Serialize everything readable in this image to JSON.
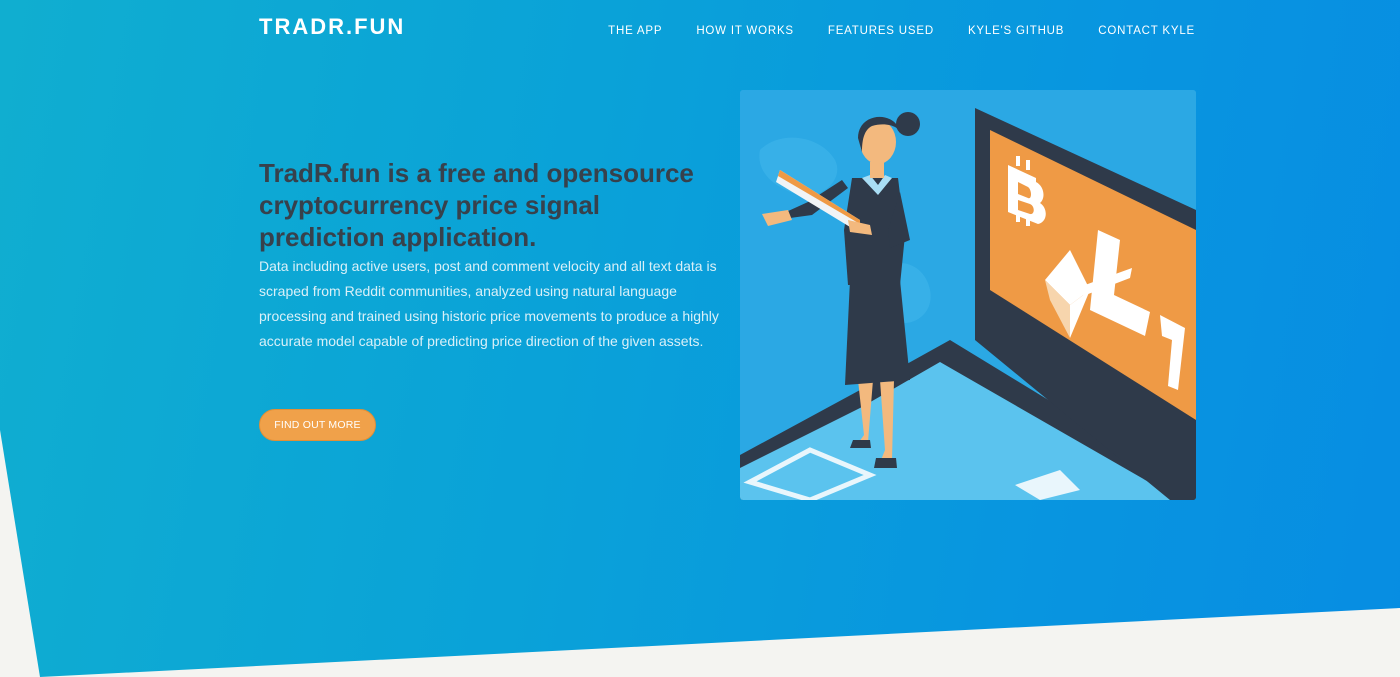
{
  "brand": {
    "name": "TRADR.FUN"
  },
  "nav": {
    "items": [
      {
        "label": "THE APP"
      },
      {
        "label": "HOW IT WORKS"
      },
      {
        "label": "FEATURES USED"
      },
      {
        "label": "KYLE'S GITHUB"
      },
      {
        "label": "CONTACT KYLE"
      }
    ]
  },
  "hero": {
    "headline": "TradR.fun is a free and opensource cryptocurrency price signal prediction application.",
    "description": "Data including active users, post and comment velocity and all text data is scraped from Reddit communities, analyzed using natural language processing and trained using historic price movements to produce a highly accurate model capable of predicting price direction of the given assets.",
    "cta_label": "FIND OUT MORE",
    "illustration": {
      "icon_names": [
        "bitcoin-icon",
        "ethereum-icon",
        "litecoin-icon"
      ]
    }
  },
  "colors": {
    "gradient_start": "#10aed0",
    "gradient_end": "#078de2",
    "headline": "#37414c",
    "cta": "#f0a14a",
    "page_background": "#f4f4f1"
  }
}
